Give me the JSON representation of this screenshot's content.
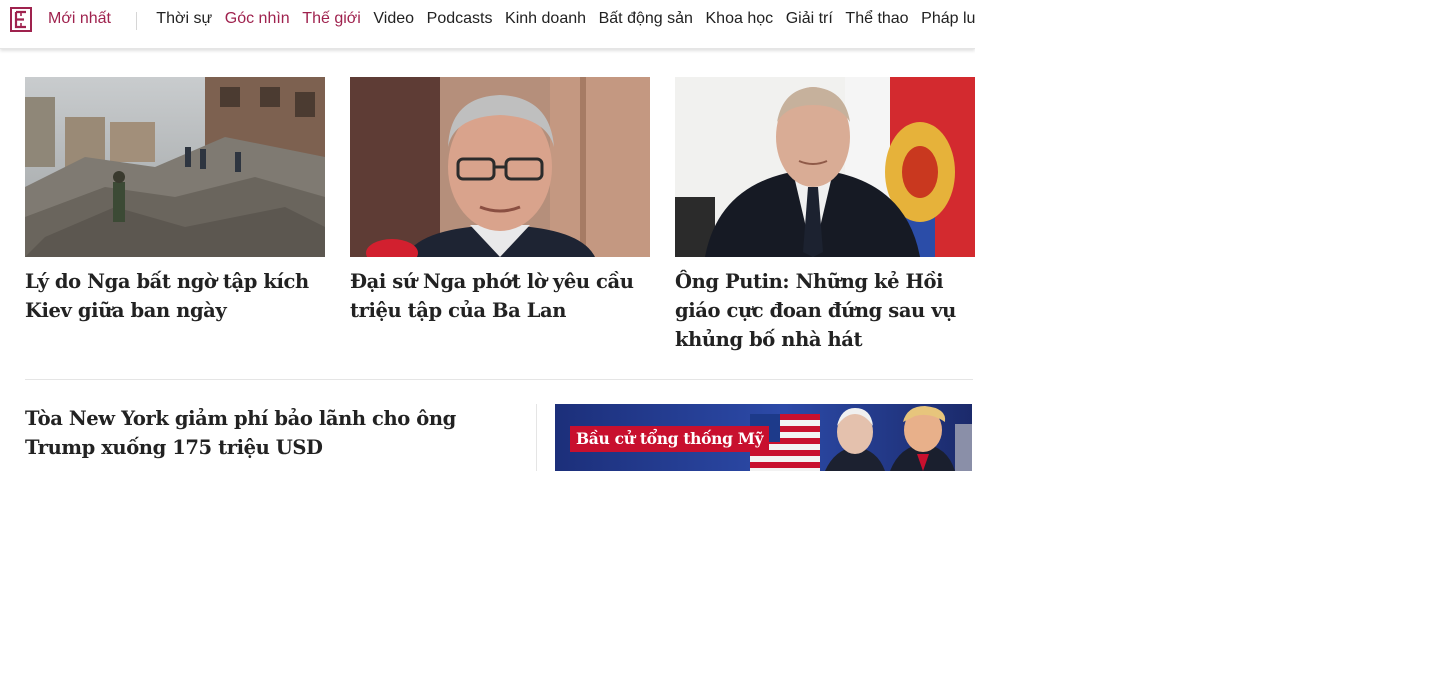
{
  "nav": {
    "latest": "Mới nhất",
    "items": [
      {
        "label": "Thời sự",
        "accent": false
      },
      {
        "label": "Góc nhìn",
        "accent": true
      },
      {
        "label": "Thế giới",
        "accent": true
      },
      {
        "label": "Video",
        "accent": false
      },
      {
        "label": "Podcasts",
        "accent": false
      },
      {
        "label": "Kinh doanh",
        "accent": false
      },
      {
        "label": "Bất động sản",
        "accent": false
      },
      {
        "label": "Khoa học",
        "accent": false
      },
      {
        "label": "Giải trí",
        "accent": false
      },
      {
        "label": "Thể thao",
        "accent": false
      },
      {
        "label": "Pháp luật",
        "accent": false
      }
    ]
  },
  "articles": [
    {
      "title": "Lý do Nga bất ngờ tập kích Kiev giữa ban ngày",
      "image": "ruined-building-photo"
    },
    {
      "title": "Đại sứ Nga phớt lờ yêu cầu triệu tập của Ba Lan",
      "image": "ambassador-portrait-photo"
    },
    {
      "title": "Ông Putin: Những kẻ Hồi giáo cực đoan đứng sau vụ khủng bố nhà hát",
      "image": "putin-speech-photo"
    }
  ],
  "lead": {
    "title": "Tòa New York giảm phí bảo lãnh cho ông Trump xuống 175 triệu USD"
  },
  "banner": {
    "label": "Bầu cử tổng thống Mỹ",
    "image": "us-election-candidates-photo"
  },
  "colors": {
    "brand": "#9f224e",
    "text": "#222222",
    "banner_tag": "#c8102e"
  }
}
